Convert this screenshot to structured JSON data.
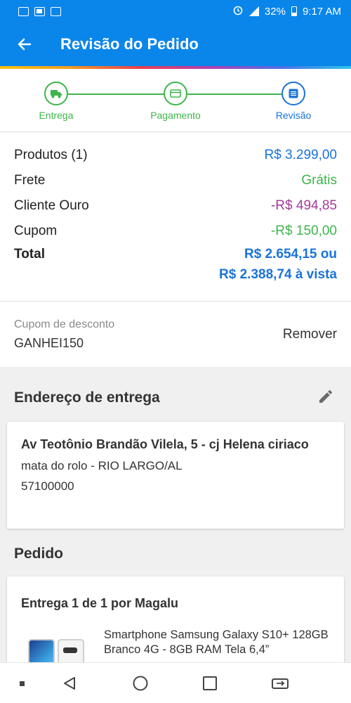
{
  "status_bar": {
    "battery": "32%",
    "time": "9:17 AM",
    "network": "4G"
  },
  "header": {
    "title": "Revisão do Pedido"
  },
  "stepper": {
    "steps": [
      {
        "label": "Entrega",
        "icon": "truck-icon",
        "state": "done"
      },
      {
        "label": "Pagamento",
        "icon": "credit-card-icon",
        "state": "done"
      },
      {
        "label": "Revisão",
        "icon": "list-icon",
        "state": "active"
      }
    ]
  },
  "summary": {
    "products_label": "Produtos (1)",
    "products_value": "R$ 3.299,00",
    "shipping_label": "Frete",
    "shipping_value": "Grátis",
    "gold_label": "Cliente Ouro",
    "gold_value": "-R$ 494,85",
    "coupon_label": "Cupom",
    "coupon_value": "-R$ 150,00",
    "total_label": "Total",
    "total_value": "R$ 2.654,15 ou",
    "total_cash": "R$ 2.388,74 à vista"
  },
  "coupon": {
    "label": "Cupom de desconto",
    "code": "GANHEI150",
    "remove_label": "Remover"
  },
  "address": {
    "title": "Endereço de entrega",
    "street": "Av Teotônio Brandão Vilela, 5 - cj Helena ciriaco",
    "district": "mata do rolo - RIO LARGO/AL",
    "zip": "57100000"
  },
  "order": {
    "title": "Pedido",
    "delivery_title": "Entrega 1 de 1 por Magalu",
    "product_name": "Smartphone Samsung Galaxy S10+ 128GB Branco 4G - 8GB RAM Tela 6,4”"
  },
  "colors": {
    "primary": "#0a86ea",
    "step_done": "#3db54a",
    "step_active": "#1a73d9",
    "price_blue": "#1a73d9",
    "free_green": "#3db54a",
    "discount_purple": "#a23a9a"
  }
}
